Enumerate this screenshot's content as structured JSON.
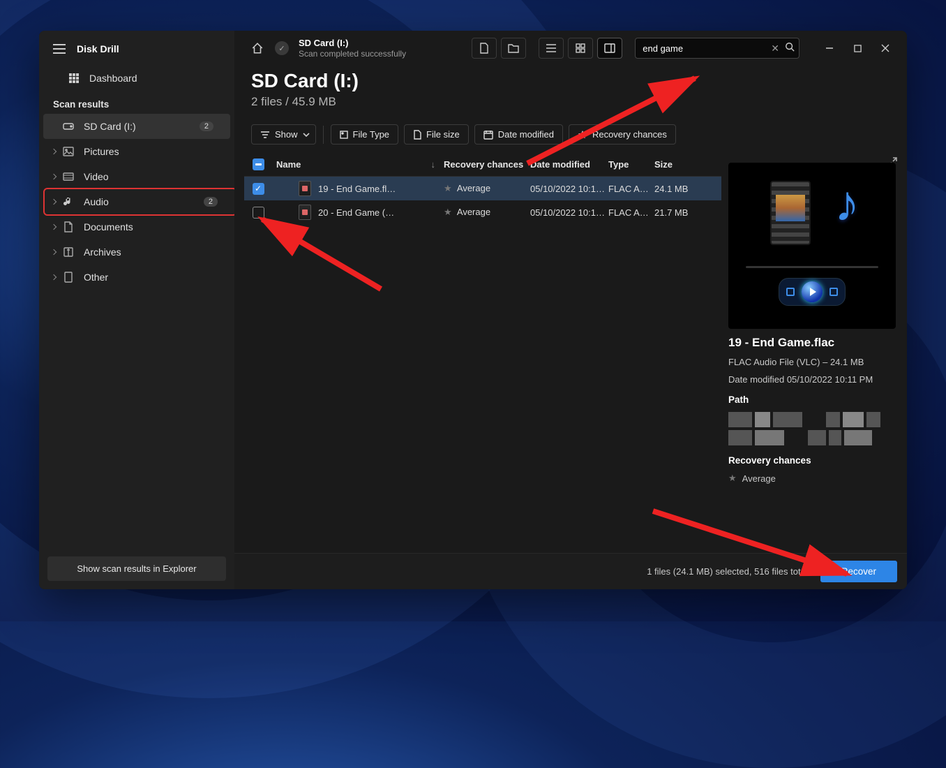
{
  "app": {
    "title": "Disk Drill"
  },
  "sidebar": {
    "dashboard": "Dashboard",
    "section_label": "Scan results",
    "items": [
      {
        "label": "SD Card (I:)",
        "badge": "2",
        "icon": "drive"
      },
      {
        "label": "Pictures",
        "icon": "image"
      },
      {
        "label": "Video",
        "icon": "video"
      },
      {
        "label": "Audio",
        "badge": "2",
        "icon": "audio"
      },
      {
        "label": "Documents",
        "icon": "doc"
      },
      {
        "label": "Archives",
        "icon": "archive"
      },
      {
        "label": "Other",
        "icon": "other"
      }
    ],
    "footer_button": "Show scan results in Explorer"
  },
  "topbar": {
    "title": "SD Card (I:)",
    "subtitle": "Scan completed successfully",
    "search_value": "end game"
  },
  "heading": {
    "title": "SD Card (I:)",
    "subtitle": "2 files / 45.9 MB"
  },
  "filters": {
    "show": "Show",
    "file_type": "File Type",
    "file_size": "File size",
    "date_modified": "Date modified",
    "recovery_chances": "Recovery chances"
  },
  "table": {
    "columns": {
      "name": "Name",
      "recovery": "Recovery chances",
      "date": "Date modified",
      "type": "Type",
      "size": "Size"
    },
    "rows": [
      {
        "checked": true,
        "name": "19 - End Game.fl…",
        "recovery": "Average",
        "date": "05/10/2022 10:1…",
        "type": "FLAC A…",
        "size": "24.1 MB"
      },
      {
        "checked": false,
        "name": "20 - End Game (…",
        "recovery": "Average",
        "date": "05/10/2022 10:1…",
        "type": "FLAC A…",
        "size": "21.7 MB"
      }
    ]
  },
  "preview": {
    "title": "19 - End Game.flac",
    "meta": "FLAC Audio File (VLC) – 24.1 MB",
    "date": "Date modified 05/10/2022 10:11 PM",
    "path_label": "Path",
    "rc_label": "Recovery chances",
    "rc_value": "Average"
  },
  "statusbar": {
    "text": "1 files (24.1 MB) selected, 516 files total",
    "recover": "Recover"
  }
}
